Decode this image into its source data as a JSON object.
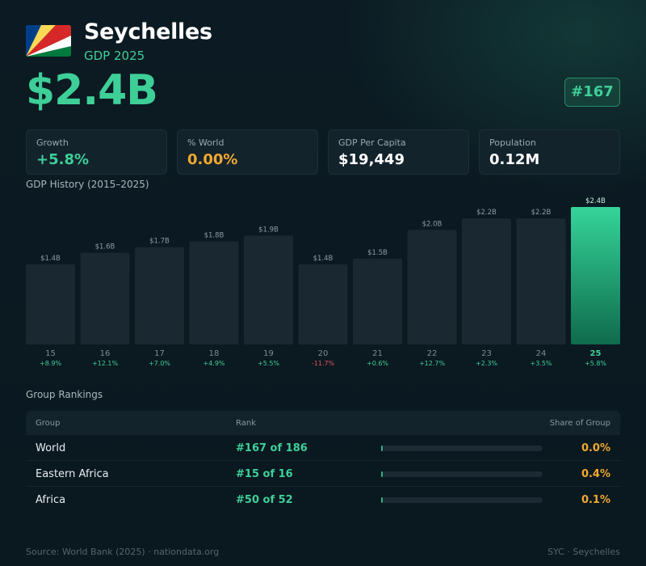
{
  "header": {
    "country": "Seychelles",
    "subtitle": "GDP 2025",
    "gdp_value": "$2.4B",
    "rank_badge": "#167",
    "flag_icon": "seychelles-flag-icon",
    "flag_colors": [
      "#003f87",
      "#fcd856",
      "#d62828",
      "#ffffff",
      "#007a3d"
    ]
  },
  "stats": [
    {
      "label": "Growth",
      "value": "+5.8%",
      "color": "#3ecf98"
    },
    {
      "label": "% World",
      "value": "0.00%",
      "color": "#f0a830"
    },
    {
      "label": "GDP Per Capita",
      "value": "$19,449",
      "color": "#ffffff"
    },
    {
      "label": "Population",
      "value": "0.12M",
      "color": "#ffffff"
    }
  ],
  "chart_title": "GDP History (2015–2025)",
  "chart_data": {
    "type": "bar",
    "categories": [
      "15",
      "16",
      "17",
      "18",
      "19",
      "20",
      "21",
      "22",
      "23",
      "24",
      "25"
    ],
    "values": [
      1.4,
      1.6,
      1.7,
      1.8,
      1.9,
      1.4,
      1.5,
      2.0,
      2.2,
      2.2,
      2.4
    ],
    "value_labels": [
      "$1.4B",
      "$1.6B",
      "$1.7B",
      "$1.8B",
      "$1.9B",
      "$1.4B",
      "$1.5B",
      "$2.0B",
      "$2.2B",
      "$2.2B",
      "$2.4B"
    ],
    "growth_labels": [
      "+8.9%",
      "+12.1%",
      "+7.0%",
      "+4.9%",
      "+5.5%",
      "-11.7%",
      "+0.6%",
      "+12.7%",
      "+2.3%",
      "+3.5%",
      "+5.8%"
    ],
    "highlight_index": 10,
    "ylim": [
      0,
      2.4
    ],
    "colors": {
      "bar": "#1a2831",
      "highlight_top": "#35d49a",
      "highlight_bottom": "#0f6b4c",
      "positive": "#3ecf98",
      "negative": "#e0525a",
      "value_label": "#8d9ba5",
      "tick": "#7d8b95"
    }
  },
  "rankings": {
    "title": "Group Rankings",
    "headers": {
      "group": "Group",
      "rank": "Rank",
      "share": "Share of Group"
    },
    "rows": [
      {
        "group": "World",
        "rank": "#167 of 186",
        "share": "0.0%",
        "share_value": 0.0
      },
      {
        "group": "Eastern Africa",
        "rank": "#15 of 16",
        "share": "0.4%",
        "share_value": 0.4
      },
      {
        "group": "Africa",
        "rank": "#50 of 52",
        "share": "0.1%",
        "share_value": 0.1
      }
    ]
  },
  "footer": {
    "source": "Source: World Bank (2025) · nationdata.org",
    "code": "SYC · Seychelles"
  }
}
